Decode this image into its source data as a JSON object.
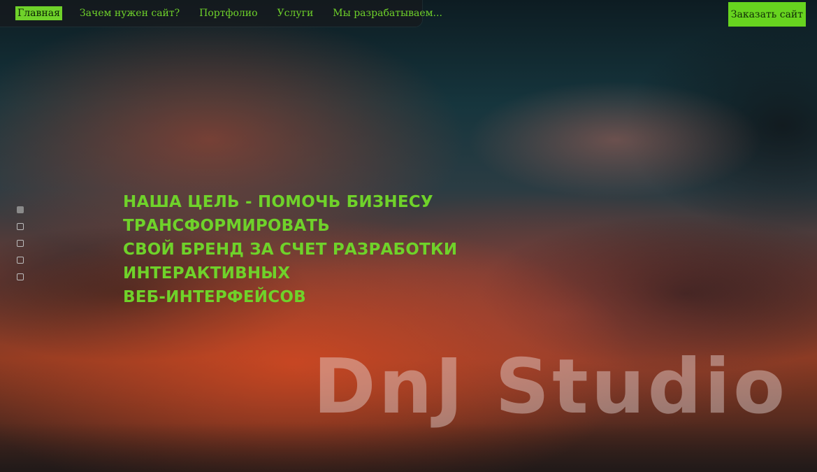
{
  "nav": {
    "items": [
      {
        "label": "Главная",
        "active": true
      },
      {
        "label": "Зачем нужен сайт?",
        "active": false
      },
      {
        "label": "Портфолио",
        "active": false
      },
      {
        "label": "Услуги",
        "active": false
      },
      {
        "label": "Мы разрабатываем...",
        "active": false
      }
    ]
  },
  "cta": {
    "label": "Заказать сайт"
  },
  "hero": {
    "line1": "Наша цель - помочь бизнесу трансформировать",
    "line2": "свой бренд за счет разработки интерактивных",
    "line3": "веб-интерфейсов"
  },
  "brand": {
    "text": "DnJ Studio"
  },
  "slider": {
    "count": 5,
    "active_index": 0
  },
  "colors": {
    "accent": "#6fd22a",
    "nav_bg": "#161a1e"
  }
}
